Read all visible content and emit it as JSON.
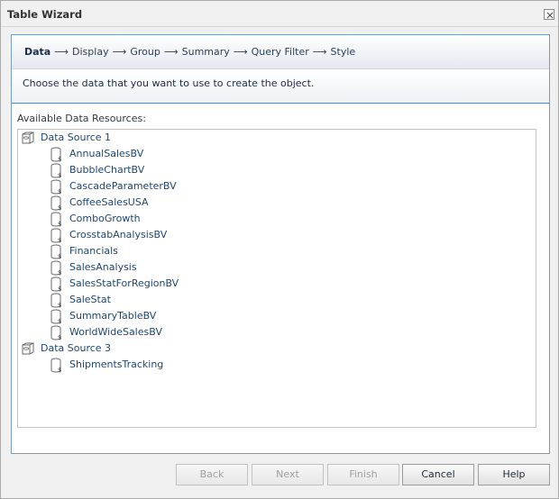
{
  "window": {
    "title": "Table Wizard"
  },
  "steps": [
    {
      "label": "Data",
      "active": true
    },
    {
      "label": "Display",
      "active": false
    },
    {
      "label": "Group",
      "active": false
    },
    {
      "label": "Summary",
      "active": false
    },
    {
      "label": "Query Filter",
      "active": false
    },
    {
      "label": "Style",
      "active": false
    }
  ],
  "step_separator": "⟶",
  "description": "Choose the data that you want to use to create the object.",
  "resources": {
    "label": "Available Data Resources:",
    "sources": [
      {
        "name": "Data Source 1",
        "icon": "data-source-icon",
        "items": [
          "AnnualSalesBV",
          "BubbleChartBV",
          "CascadeParameterBV",
          "CoffeeSalesUSA",
          "ComboGrowth",
          "CrosstabAnalysisBV",
          "Financials",
          "SalesAnalysis",
          "SalesStatForRegionBV",
          "SaleStat",
          "SummaryTableBV",
          "WorldWideSalesBV"
        ]
      },
      {
        "name": "Data Source 3",
        "icon": "data-source-icon",
        "items": [
          "ShipmentsTracking"
        ]
      }
    ],
    "item_icon": "business-view-icon"
  },
  "buttons": {
    "back": {
      "label": "Back",
      "enabled": false
    },
    "next": {
      "label": "Next",
      "enabled": false
    },
    "finish": {
      "label": "Finish",
      "enabled": false
    },
    "cancel": {
      "label": "Cancel",
      "enabled": true
    },
    "help": {
      "label": "Help",
      "enabled": true
    }
  }
}
